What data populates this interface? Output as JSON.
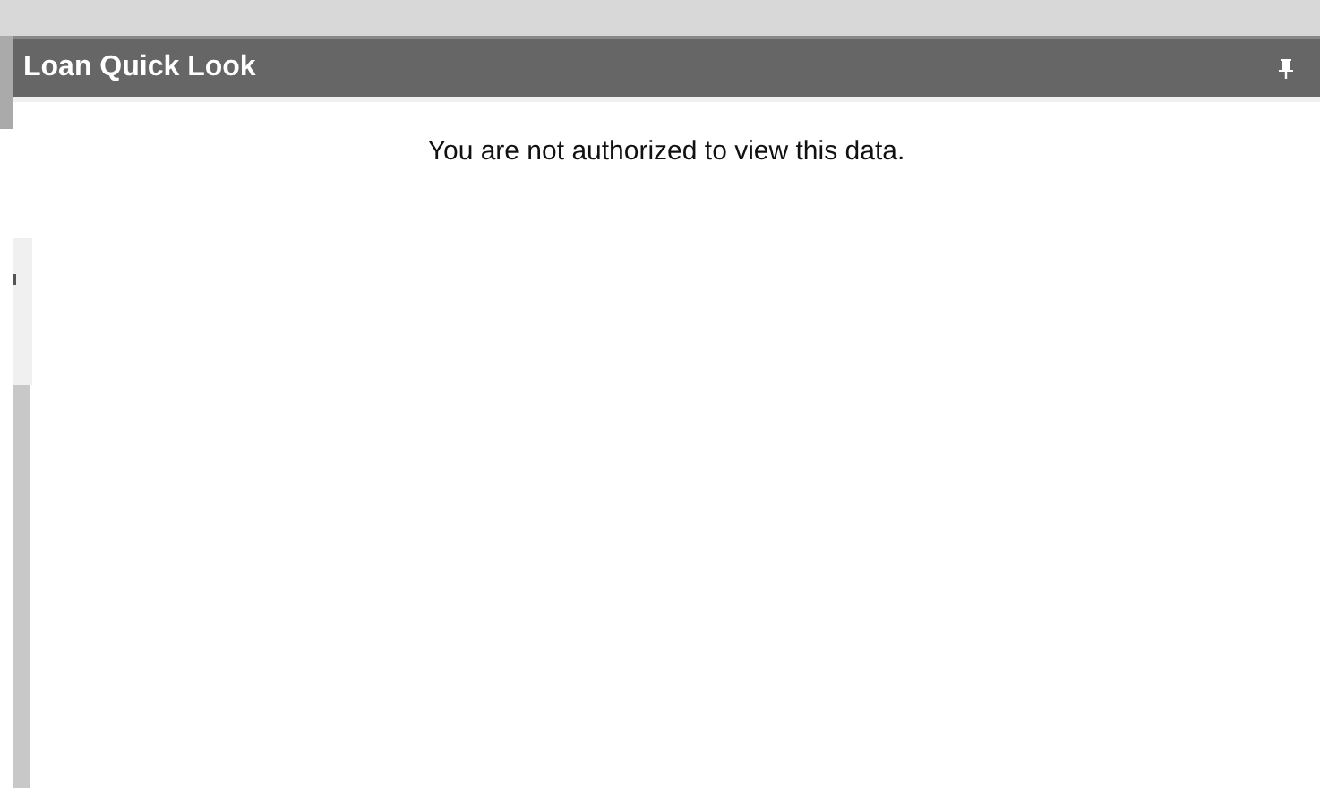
{
  "panel": {
    "title": "Loan Quick Look",
    "message": "You are not authorized to view this data."
  }
}
